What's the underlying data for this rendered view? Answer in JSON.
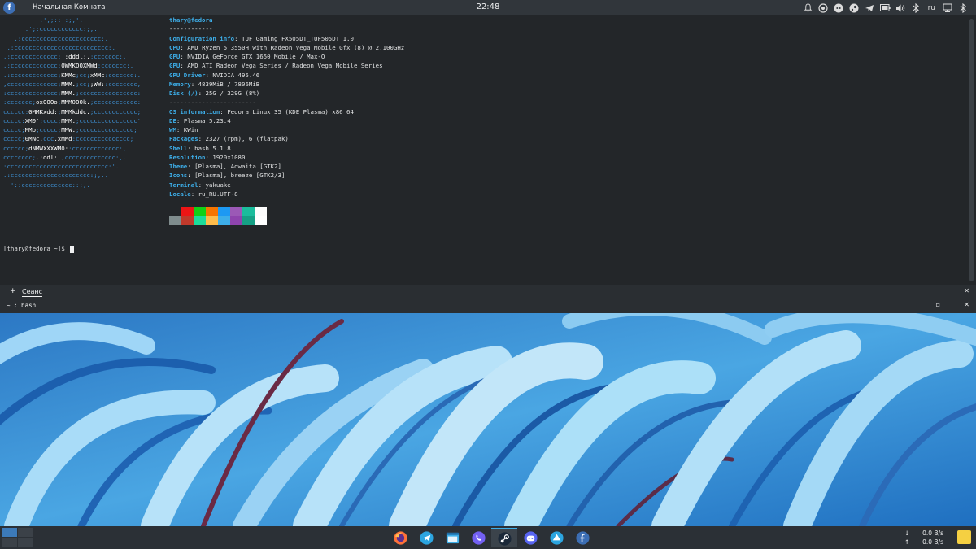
{
  "top_panel": {
    "launcher_icon": "fedora-icon",
    "window_title": "Начальная Комната",
    "clock": "22:48",
    "keyboard_layout": "ru"
  },
  "terminal": {
    "user_host": "thary@fedora",
    "separator": "------------",
    "info": [
      {
        "k": "Configuration info",
        "v": "TUF Gaming FX505DT_TUF505DT 1.0"
      },
      {
        "k": "CPU",
        "v": "AMD Ryzen 5 3550H with Radeon Vega Mobile Gfx (8) @ 2.100GHz"
      },
      {
        "k": "GPU",
        "v": "NVIDIA GeForce GTX 1650 Mobile / Max-Q"
      },
      {
        "k": "GPU",
        "v": "AMD ATI Radeon Vega Series / Radeon Vega Mobile Series"
      },
      {
        "k": "GPU Driver",
        "v": "NVIDIA 495.46"
      },
      {
        "k": "Memory",
        "v": "4839MiB / 7806MiB"
      },
      {
        "k": "Disk (/)",
        "v": "25G / 329G (8%)"
      }
    ],
    "separator2": "------------------------",
    "info2": [
      {
        "k": "OS information",
        "v": "Fedora Linux 35 (KDE Plasma) x86_64"
      },
      {
        "k": "DE",
        "v": "Plasma 5.23.4"
      },
      {
        "k": "WM",
        "v": "KWin"
      },
      {
        "k": "Packages",
        "v": "2327 (rpm), 6 (flatpak)"
      },
      {
        "k": "Shell",
        "v": "bash 5.1.8"
      },
      {
        "k": "Resolution",
        "v": "1920x1080"
      },
      {
        "k": "Theme",
        "v": "[Plasma], Adwaita [GTK2]"
      },
      {
        "k": "Icons",
        "v": "[Plasma], breeze [GTK2/3]"
      },
      {
        "k": "Terminal",
        "v": "yakuake"
      },
      {
        "k": "Locale",
        "v": "ru_RU.UTF-8"
      }
    ],
    "palette_top": [
      "#232629",
      "#ed1515",
      "#11d116",
      "#f67400",
      "#1d99f3",
      "#9b59b6",
      "#1abc9c",
      "#fcfcfc"
    ],
    "palette_bottom": [
      "#7f8c8d",
      "#c0392b",
      "#1cdc9a",
      "#fdbc4b",
      "#3daee9",
      "#8e44ad",
      "#16a085",
      "#ffffff"
    ],
    "prompt": "[thary@fedora ~]$ "
  },
  "tabbar": {
    "new_tab_icon": "+",
    "session_label": "Сеанс",
    "path_label": "~ : bash"
  },
  "bottom_panel": {
    "tasks": [
      "firefox",
      "telegram",
      "file-manager",
      "viber",
      "steam",
      "discord",
      "kotatogram",
      "fedora"
    ],
    "net_down_arrow": "↓",
    "net_up_arrow": "↑",
    "net_down": "0.0 B/s",
    "net_up": "0.0 B/s"
  },
  "colors": {
    "terminal_bg": "#232629",
    "accent": "#3daee9",
    "logo_blue": "#3d8fd1"
  }
}
